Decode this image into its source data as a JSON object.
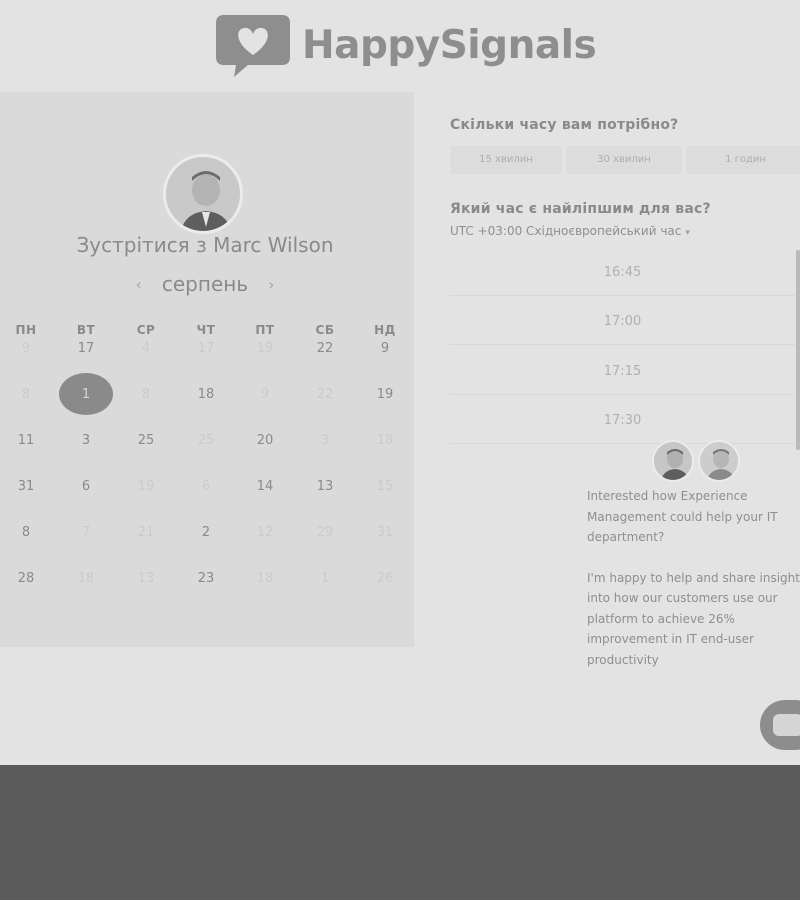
{
  "brand": {
    "name": "HappySignals"
  },
  "calendar": {
    "title": "Зустрітися з Marc Wilson",
    "month": "серпень",
    "weekdays": [
      "ПН",
      "ВТ",
      "СР",
      "ЧТ",
      "ПТ",
      "СБ",
      "НД"
    ],
    "weeks": [
      [
        {
          "d": "9",
          "s": "dim"
        },
        {
          "d": "17",
          "s": "active"
        },
        {
          "d": "4",
          "s": "dim"
        },
        {
          "d": "17",
          "s": "dim"
        },
        {
          "d": "19",
          "s": "dim"
        },
        {
          "d": "22",
          "s": "active"
        },
        {
          "d": "9",
          "s": "active"
        }
      ],
      [
        {
          "d": "8",
          "s": "dim"
        },
        {
          "d": "1",
          "s": "selected"
        },
        {
          "d": "8",
          "s": "dim"
        },
        {
          "d": "18",
          "s": "active"
        },
        {
          "d": "9",
          "s": "dim"
        },
        {
          "d": "22",
          "s": "dim"
        },
        {
          "d": "19",
          "s": "active"
        }
      ],
      [
        {
          "d": "11",
          "s": "active"
        },
        {
          "d": "3",
          "s": "active"
        },
        {
          "d": "25",
          "s": "active"
        },
        {
          "d": "25",
          "s": "dim"
        },
        {
          "d": "20",
          "s": "active"
        },
        {
          "d": "3",
          "s": "dim"
        },
        {
          "d": "18",
          "s": "dim"
        }
      ],
      [
        {
          "d": "31",
          "s": "active"
        },
        {
          "d": "6",
          "s": "active"
        },
        {
          "d": "19",
          "s": "dim"
        },
        {
          "d": "6",
          "s": "dim"
        },
        {
          "d": "14",
          "s": "active"
        },
        {
          "d": "13",
          "s": "active"
        },
        {
          "d": "15",
          "s": "dim"
        }
      ],
      [
        {
          "d": "8",
          "s": "active"
        },
        {
          "d": "7",
          "s": "dim"
        },
        {
          "d": "21",
          "s": "dim"
        },
        {
          "d": "2",
          "s": "active"
        },
        {
          "d": "12",
          "s": "dim"
        },
        {
          "d": "29",
          "s": "dim"
        },
        {
          "d": "31",
          "s": "dim"
        }
      ],
      [
        {
          "d": "28",
          "s": "active"
        },
        {
          "d": "18",
          "s": "dim"
        },
        {
          "d": "13",
          "s": "dim"
        },
        {
          "d": "23",
          "s": "active"
        },
        {
          "d": "18",
          "s": "dim"
        },
        {
          "d": "1",
          "s": "dim"
        },
        {
          "d": "26",
          "s": "dim"
        }
      ]
    ]
  },
  "booking": {
    "duration_question": "Скільки часу вам потрібно?",
    "durations": [
      "15 хвилин",
      "30 хвилин",
      "1 годин"
    ],
    "time_question": "Який час є найліпшим для вас?",
    "timezone": "UTC +03:00 Східноєвропейський час",
    "slots": [
      "16:45",
      "17:00",
      "17:15",
      "17:30"
    ]
  },
  "chat": {
    "message_1": "Interested how Experience Management could help your IT department?",
    "message_2": "I'm happy to help and share insight into how our customers use our platform to achieve 26% improvement in IT end-user productivity"
  }
}
